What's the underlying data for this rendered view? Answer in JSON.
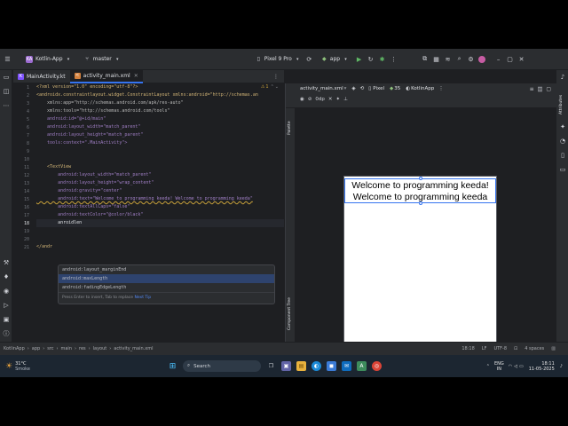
{
  "toolbar": {
    "project": "Kotlin-App",
    "branch": "master",
    "device": "Pixel 9 Pro",
    "run_config": "app"
  },
  "tabs": [
    {
      "label": "MainActivity.kt"
    },
    {
      "label": "activity_main.xml"
    }
  ],
  "editor": {
    "line_numbers": [
      "1",
      "2",
      "3",
      "4",
      "5",
      "6",
      "7",
      "8",
      "9",
      "10",
      "11",
      "12",
      "13",
      "14",
      "15",
      "16",
      "17",
      "18",
      "19",
      "20",
      "21"
    ],
    "lines": [
      "<?xml version=\"1.0\" encoding=\"utf-8\"?>",
      "<androidx.constraintlayout.widget.ConstraintLayout xmlns:android=\"http://schemas.an",
      "    xmlns:app=\"http://schemas.android.com/apk/res-auto\"",
      "    xmlns:tools=\"http://schemas.android.com/tools\"",
      "    android:id=\"@+id/main\"",
      "    android:layout_width=\"match_parent\"",
      "    android:layout_height=\"match_parent\"",
      "    tools:context=\".MainActivity\">",
      "",
      "",
      "    <TextView",
      "        android:layout_width=\"match_parent\"",
      "        android:layout_height=\"wrap_content\"",
      "        android:gravity=\"center\"",
      "        android:text=\"Welcome to programming keeda! Welcome to programming keeda\"",
      "        android:textAllCaps=\"false\"",
      "        android:textColor=\"@color/black\"",
      "        anroidlen",
      "",
      "",
      "</andr"
    ],
    "warning_count": "1",
    "autocomplete": {
      "items": [
        "android:layout_marginEnd",
        "android:maxLength",
        "android:fadingEdgeLength"
      ],
      "hint_prefix": "Press Enter to insert, Tab to replace",
      "hint_link": "Next Tip"
    }
  },
  "design": {
    "file": "activity_main.xml",
    "device": "Pixel",
    "api": "35",
    "theme": "KotlinApp",
    "zoom_value": "0dp",
    "palette_label": "Palette",
    "component_tree_label": "Component Tree",
    "attributes_label": "Attributes",
    "preview_text": "Welcome to programming keeda! Welcome to programming keeda"
  },
  "statusbar": {
    "breadcrumbs": [
      "KotlinApp",
      "app",
      "src",
      "main",
      "res",
      "layout",
      "activity_main.xml"
    ],
    "position": "18:18",
    "line_sep": "LF",
    "encoding": "UTF-8",
    "indent": "4 spaces"
  },
  "taskbar": {
    "weather_temp": "31°C",
    "weather_desc": "Smoke",
    "search_label": "Search",
    "lang": "ENG",
    "region": "IN",
    "time": "18:11",
    "date": "11-05-2025"
  },
  "colors": {
    "accent": "#3574f0",
    "ide_bg": "#1e1f22",
    "panel_bg": "#2b2d30",
    "taskbar_bg": "#1c2631"
  }
}
